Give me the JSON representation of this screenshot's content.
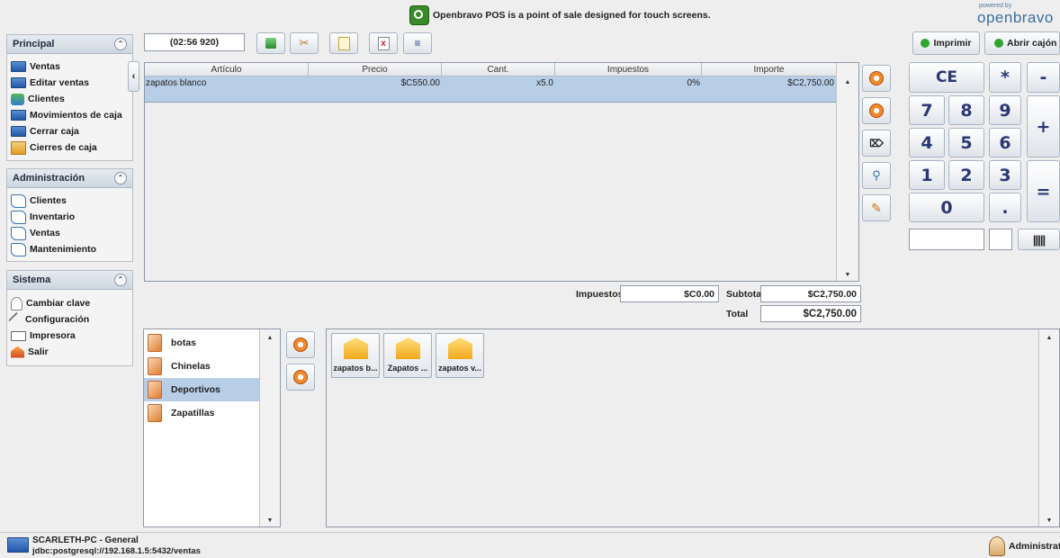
{
  "header": {
    "banner_text": "Openbravo POS is a point of sale designed for touch screens.",
    "powered_by": "powered by",
    "brand": "openbravo"
  },
  "sidebar": {
    "principal": {
      "title": "Principal",
      "items": [
        {
          "label": "Ventas",
          "icon": "monitor-icon"
        },
        {
          "label": "Editar ventas",
          "icon": "monitor-icon"
        },
        {
          "label": "Clientes",
          "icon": "people-icon"
        },
        {
          "label": "Movimientos de caja",
          "icon": "monitor-icon"
        },
        {
          "label": "Cerrar caja",
          "icon": "monitor-icon"
        },
        {
          "label": "Cierres de caja",
          "icon": "cash-icon"
        }
      ]
    },
    "administracion": {
      "title": "Administración",
      "items": [
        {
          "label": "Clientes",
          "icon": "book-icon"
        },
        {
          "label": "Inventario",
          "icon": "book-icon"
        },
        {
          "label": "Ventas",
          "icon": "book-icon"
        },
        {
          "label": "Mantenimiento",
          "icon": "book-icon"
        }
      ]
    },
    "sistema": {
      "title": "Sistema",
      "items": [
        {
          "label": "Cambiar clave",
          "icon": "key-icon"
        },
        {
          "label": "Configuración",
          "icon": "tools-icon"
        },
        {
          "label": "Impresora",
          "icon": "printer-icon"
        },
        {
          "label": "Salir",
          "icon": "home-icon"
        }
      ]
    }
  },
  "toolbar": {
    "ticket_id": "(02:56 920)",
    "print_label": "Imprimir",
    "open_drawer_label": "Abrir cajón"
  },
  "ticket": {
    "columns": [
      "Artículo",
      "Precio",
      "Cant.",
      "Impuestos",
      "Importe"
    ],
    "rows": [
      {
        "articulo": "zapatos blanco",
        "precio": "$C550.00",
        "cant": "x5.0",
        "impuestos": "0%",
        "importe": "$C2,750.00"
      }
    ]
  },
  "totals": {
    "tax_label": "Impuestos",
    "tax_value": "$C0.00",
    "subtotal_label": "Subtotal",
    "subtotal_value": "$C2,750.00",
    "total_label": "Total",
    "total_value": "$C2,750.00"
  },
  "keypad": {
    "ce": "CE",
    "multiply": "*",
    "minus": "-",
    "plus": "+",
    "equals": "=",
    "n7": "7",
    "n8": "8",
    "n9": "9",
    "n4": "4",
    "n5": "5",
    "n6": "6",
    "n1": "1",
    "n2": "2",
    "n3": "3",
    "n0": "0",
    "dot": "."
  },
  "categories": [
    {
      "label": "botas",
      "selected": false
    },
    {
      "label": "Chinelas",
      "selected": false
    },
    {
      "label": "Deportivos",
      "selected": true
    },
    {
      "label": "Zapatillas",
      "selected": false
    }
  ],
  "products": [
    {
      "label": "zapatos b..."
    },
    {
      "label": "Zapatos ..."
    },
    {
      "label": "zapatos v..."
    }
  ],
  "status": {
    "host": "SCARLETH-PC - General",
    "db_url": "jdbc:postgresql://192.168.1.5:5432/ventas",
    "user": "Administrat"
  },
  "colors": {
    "selection": "#b8cde6",
    "keypad_text": "#2a3775",
    "status_green": "#2fa52f"
  }
}
